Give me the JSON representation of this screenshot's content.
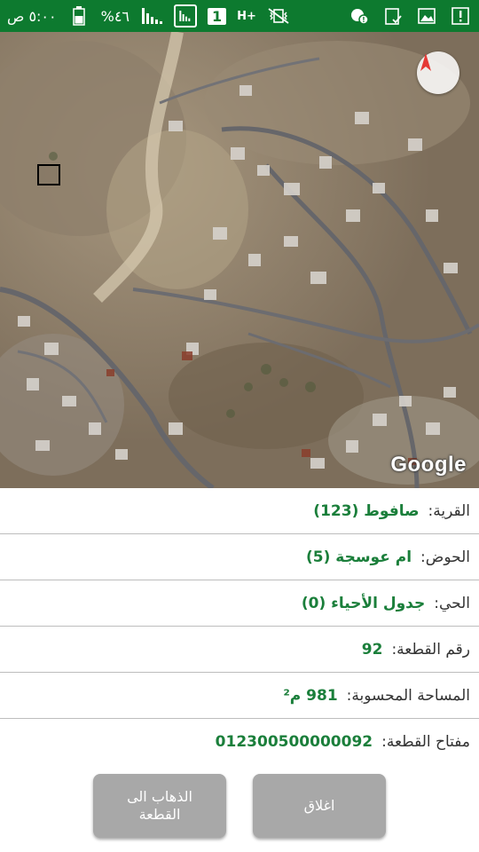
{
  "status_bar": {
    "time": "٥:٠٠ ص",
    "battery": "%٤٦",
    "sim_slot": "1",
    "network": "H+"
  },
  "map": {
    "attribution": "Google",
    "compass_icon": "compass-north-icon"
  },
  "parcel": {
    "village_label": "القرية:",
    "village_value": "صافوط (123)",
    "basin_label": "الحوض:",
    "basin_value": "ام عوسجة (5)",
    "district_label": "الحي:",
    "district_value": "جدول الأحياء (0)",
    "number_label": "رقم القطعة:",
    "number_value": "92",
    "area_label": "المساحة المحسوبة:",
    "area_value": "981 م²",
    "key_label": "مفتاح القطعة:",
    "key_value": "012300500000092"
  },
  "buttons": {
    "close_label": "اغلاق",
    "goto_label": "الذهاب الى القطعة"
  },
  "colors": {
    "status_bar": "#0d7a2f",
    "value_text": "#1b7f3b",
    "button_bg": "#a8a8a8"
  }
}
